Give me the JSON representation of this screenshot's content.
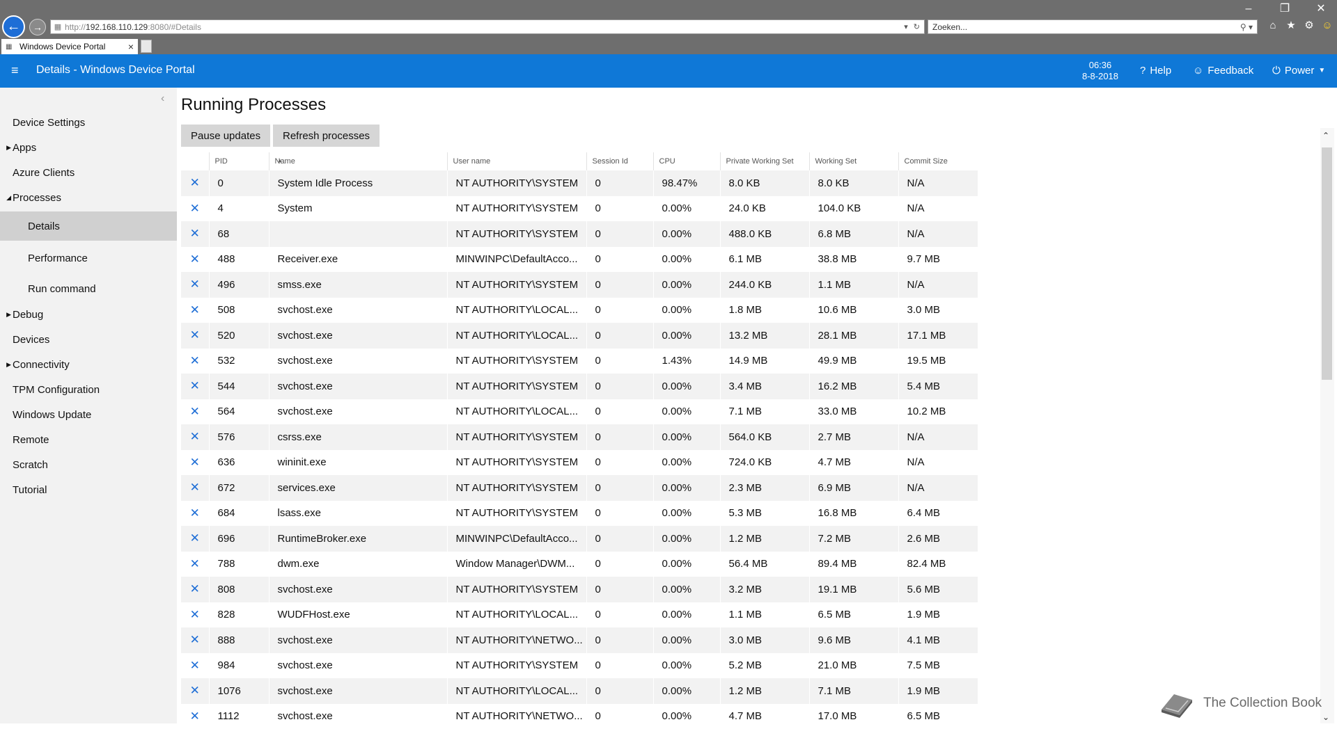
{
  "browser": {
    "url_prefix": "http://",
    "url_host": "192.168.110.129",
    "url_rest": ":8080/#Details",
    "search_placeholder": "Zoeken...",
    "tab_title": "Windows Device Portal"
  },
  "header": {
    "title": "Details - Windows Device Portal",
    "time": "06:36",
    "date": "8-8-2018",
    "help": "Help",
    "feedback": "Feedback",
    "power": "Power",
    "brand_color": "#0f78d7"
  },
  "sidebar": {
    "items": [
      {
        "label": "Device Settings"
      },
      {
        "label": "Apps"
      },
      {
        "label": "Azure Clients"
      },
      {
        "label": "Processes"
      },
      {
        "label": "Details"
      },
      {
        "label": "Performance"
      },
      {
        "label": "Run command"
      },
      {
        "label": "Debug"
      },
      {
        "label": "Devices"
      },
      {
        "label": "Connectivity"
      },
      {
        "label": "TPM Configuration"
      },
      {
        "label": "Windows Update"
      },
      {
        "label": "Remote"
      },
      {
        "label": "Scratch"
      },
      {
        "label": "Tutorial"
      }
    ]
  },
  "main": {
    "title": "Running Processes",
    "pause_label": "Pause updates",
    "refresh_label": "Refresh processes",
    "columns": [
      "PID",
      "Name",
      "User name",
      "Session Id",
      "CPU",
      "Private Working Set",
      "Working Set",
      "Commit Size"
    ],
    "rows": [
      [
        "0",
        "System Idle Process",
        "NT AUTHORITY\\SYSTEM",
        "0",
        "98.47%",
        "8.0 KB",
        "8.0 KB",
        "N/A"
      ],
      [
        "4",
        "System",
        "NT AUTHORITY\\SYSTEM",
        "0",
        "0.00%",
        "24.0 KB",
        "104.0 KB",
        "N/A"
      ],
      [
        "68",
        "",
        "NT AUTHORITY\\SYSTEM",
        "0",
        "0.00%",
        "488.0 KB",
        "6.8 MB",
        "N/A"
      ],
      [
        "488",
        "Receiver.exe",
        "MINWINPC\\DefaultAcco...",
        "0",
        "0.00%",
        "6.1 MB",
        "38.8 MB",
        "9.7 MB"
      ],
      [
        "496",
        "smss.exe",
        "NT AUTHORITY\\SYSTEM",
        "0",
        "0.00%",
        "244.0 KB",
        "1.1 MB",
        "N/A"
      ],
      [
        "508",
        "svchost.exe",
        "NT AUTHORITY\\LOCAL...",
        "0",
        "0.00%",
        "1.8 MB",
        "10.6 MB",
        "3.0 MB"
      ],
      [
        "520",
        "svchost.exe",
        "NT AUTHORITY\\LOCAL...",
        "0",
        "0.00%",
        "13.2 MB",
        "28.1 MB",
        "17.1 MB"
      ],
      [
        "532",
        "svchost.exe",
        "NT AUTHORITY\\SYSTEM",
        "0",
        "1.43%",
        "14.9 MB",
        "49.9 MB",
        "19.5 MB"
      ],
      [
        "544",
        "svchost.exe",
        "NT AUTHORITY\\SYSTEM",
        "0",
        "0.00%",
        "3.4 MB",
        "16.2 MB",
        "5.4 MB"
      ],
      [
        "564",
        "svchost.exe",
        "NT AUTHORITY\\LOCAL...",
        "0",
        "0.00%",
        "7.1 MB",
        "33.0 MB",
        "10.2 MB"
      ],
      [
        "576",
        "csrss.exe",
        "NT AUTHORITY\\SYSTEM",
        "0",
        "0.00%",
        "564.0 KB",
        "2.7 MB",
        "N/A"
      ],
      [
        "636",
        "wininit.exe",
        "NT AUTHORITY\\SYSTEM",
        "0",
        "0.00%",
        "724.0 KB",
        "4.7 MB",
        "N/A"
      ],
      [
        "672",
        "services.exe",
        "NT AUTHORITY\\SYSTEM",
        "0",
        "0.00%",
        "2.3 MB",
        "6.9 MB",
        "N/A"
      ],
      [
        "684",
        "lsass.exe",
        "NT AUTHORITY\\SYSTEM",
        "0",
        "0.00%",
        "5.3 MB",
        "16.8 MB",
        "6.4 MB"
      ],
      [
        "696",
        "RuntimeBroker.exe",
        "MINWINPC\\DefaultAcco...",
        "0",
        "0.00%",
        "1.2 MB",
        "7.2 MB",
        "2.6 MB"
      ],
      [
        "788",
        "dwm.exe",
        "Window Manager\\DWM...",
        "0",
        "0.00%",
        "56.4 MB",
        "89.4 MB",
        "82.4 MB"
      ],
      [
        "808",
        "svchost.exe",
        "NT AUTHORITY\\SYSTEM",
        "0",
        "0.00%",
        "3.2 MB",
        "19.1 MB",
        "5.6 MB"
      ],
      [
        "828",
        "WUDFHost.exe",
        "NT AUTHORITY\\LOCAL...",
        "0",
        "0.00%",
        "1.1 MB",
        "6.5 MB",
        "1.9 MB"
      ],
      [
        "888",
        "svchost.exe",
        "NT AUTHORITY\\NETWO...",
        "0",
        "0.00%",
        "3.0 MB",
        "9.6 MB",
        "4.1 MB"
      ],
      [
        "984",
        "svchost.exe",
        "NT AUTHORITY\\SYSTEM",
        "0",
        "0.00%",
        "5.2 MB",
        "21.0 MB",
        "7.5 MB"
      ],
      [
        "1076",
        "svchost.exe",
        "NT AUTHORITY\\LOCAL...",
        "0",
        "0.00%",
        "1.2 MB",
        "7.1 MB",
        "1.9 MB"
      ],
      [
        "1112",
        "svchost.exe",
        "NT AUTHORITY\\NETWO...",
        "0",
        "0.00%",
        "4.7 MB",
        "17.0 MB",
        "6.5 MB"
      ]
    ]
  },
  "watermark": {
    "text": "The Collection Book"
  }
}
